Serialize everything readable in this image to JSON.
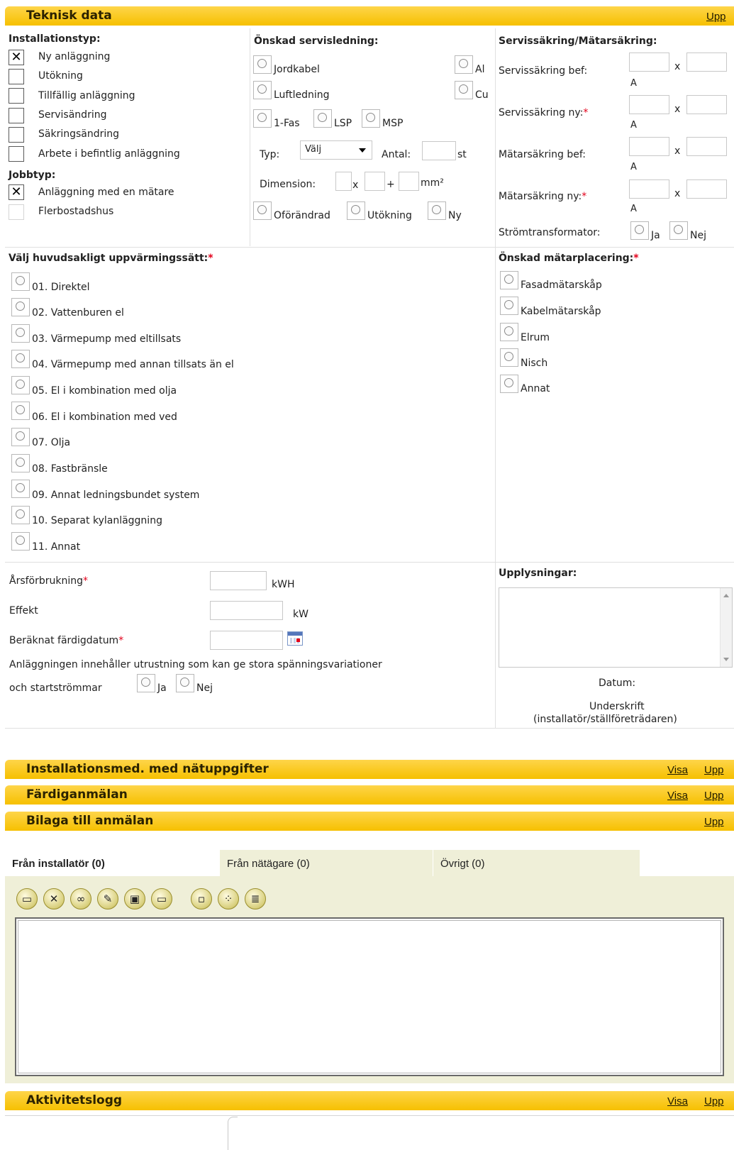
{
  "sections": {
    "teknisk": {
      "title": "Teknisk data",
      "upp": "Upp"
    },
    "installationsmed": {
      "title": "Installationsmed. med nätuppgifter",
      "visa": "Visa",
      "upp": "Upp"
    },
    "fardig": {
      "title": "Färdiganmälan",
      "visa": "Visa",
      "upp": "Upp"
    },
    "bilaga": {
      "title": "Bilaga till anmälan",
      "upp": "Upp"
    },
    "aktivitet": {
      "title": "Aktivitetslogg",
      "visa": "Visa",
      "upp": "Upp"
    }
  },
  "installationstyp": {
    "heading": "Installationstyp:",
    "items": [
      {
        "label": "Ny anläggning",
        "mark": "✕"
      },
      {
        "label": "Utökning",
        "mark": ""
      },
      {
        "label": "Tillfällig anläggning",
        "mark": ""
      },
      {
        "label": "Servisändring",
        "mark": ""
      },
      {
        "label": "Säkringsändring",
        "mark": ""
      },
      {
        "label": "Arbete i befintlig anläggning",
        "mark": ""
      }
    ]
  },
  "jobbtyp": {
    "heading": "Jobbtyp:",
    "items": [
      {
        "label": "Anläggning med en mätare",
        "mark": "✕"
      },
      {
        "label": "Flerbostadshus",
        "mark": ""
      }
    ]
  },
  "servisledning": {
    "heading": "Önskad servisledning:",
    "jordkabel": "Jordkabel",
    "luftledning": "Luftledning",
    "al": "Al",
    "cu": "Cu",
    "fas": "1-Fas",
    "lsp": "LSP",
    "msp": "MSP",
    "typ_label": "Typ:",
    "typ_value": "Välj",
    "antal_label": "Antal:",
    "antal_unit": "st",
    "dim_label": "Dimension:",
    "dim_x": "x",
    "dim_plus": "+",
    "dim_unit": "mm²",
    "oforandrad": "Oförändrad",
    "utokning": "Utökning",
    "ny": "Ny"
  },
  "sakring": {
    "heading": "Servissäkring/Mätarsäkring:",
    "rows": [
      {
        "label": "Servissäkring bef:",
        "req": "",
        "x": "x",
        "unit": "A"
      },
      {
        "label": "Servissäkring ny:",
        "req": "*",
        "x": "x",
        "unit": "A"
      },
      {
        "label": "Mätarsäkring bef:",
        "req": "",
        "x": "x",
        "unit": "A"
      },
      {
        "label": "Mätarsäkring ny:",
        "req": "*",
        "x": "x",
        "unit": "A"
      }
    ],
    "stromtrans": "Strömtransformator:",
    "ja": "Ja",
    "nej": "Nej"
  },
  "uppvarmning": {
    "heading": "Välj huvudsakligt uppvärmingssätt:",
    "req": "*",
    "items": [
      "01. Direktel",
      "02. Vattenburen el",
      "03. Värmepump med eltillsats",
      "04. Värmepump med annan tillsats än el",
      "05. El i kombination med olja",
      "06. El i kombination med ved",
      "07. Olja",
      "08. Fastbränsle",
      "09. Annat ledningsbundet system",
      "10. Separat kylanläggning",
      "11. Annat"
    ]
  },
  "matarplacering": {
    "heading": "Önskad mätarplacering:",
    "req": "*",
    "items": [
      "Fasadmätarskåp",
      "Kabelmätarskåp",
      "Elrum",
      "Nisch",
      "Annat"
    ]
  },
  "forbrukning": {
    "arsf_label": "Årsförbrukning",
    "arsf_unit": "kWH",
    "effekt_label": "Effekt",
    "effekt_unit": "kW",
    "datum_label": "Beräknat färdigdatum",
    "req": "*",
    "line1": "Anläggningen innehåller utrustning som kan ge stora spänningsvariationer",
    "line2": "och startströmmar",
    "ja": "Ja",
    "nej": "Nej"
  },
  "upplysningar": {
    "heading": "Upplysningar:",
    "datum": "Datum:",
    "underskrift": "Underskrift",
    "underskrift2": "(installatör/ställföreträdaren)"
  },
  "tabs": [
    {
      "label": "Från installatör (0)"
    },
    {
      "label": "Från nätägare (0)"
    },
    {
      "label": "Övrigt (0)"
    }
  ],
  "colors": {
    "accent": "#f6c000",
    "required": "#e2001a",
    "tabpanel": "#efefd8"
  }
}
